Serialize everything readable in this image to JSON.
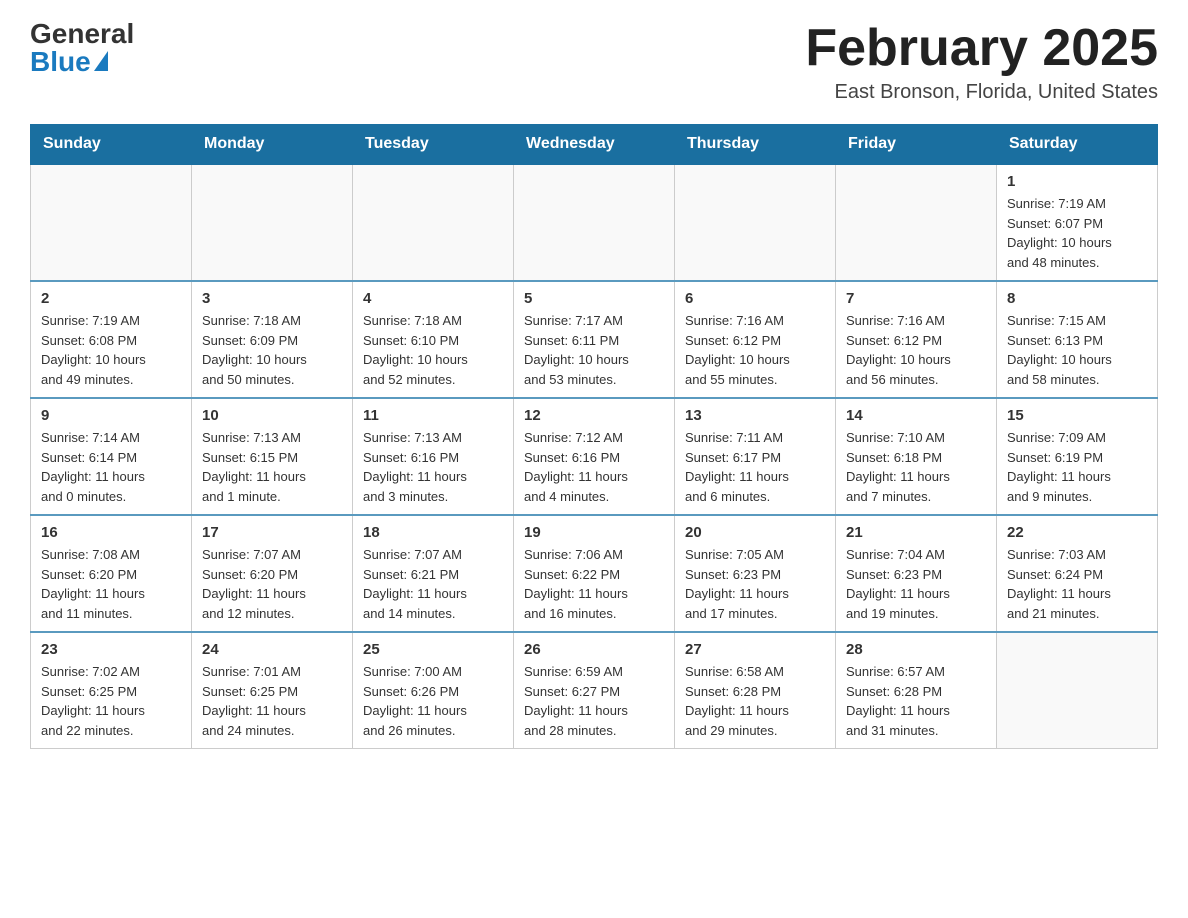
{
  "logo": {
    "general": "General",
    "blue": "Blue"
  },
  "title": "February 2025",
  "location": "East Bronson, Florida, United States",
  "days_of_week": [
    "Sunday",
    "Monday",
    "Tuesday",
    "Wednesday",
    "Thursday",
    "Friday",
    "Saturday"
  ],
  "weeks": [
    [
      {
        "day": "",
        "info": ""
      },
      {
        "day": "",
        "info": ""
      },
      {
        "day": "",
        "info": ""
      },
      {
        "day": "",
        "info": ""
      },
      {
        "day": "",
        "info": ""
      },
      {
        "day": "",
        "info": ""
      },
      {
        "day": "1",
        "info": "Sunrise: 7:19 AM\nSunset: 6:07 PM\nDaylight: 10 hours\nand 48 minutes."
      }
    ],
    [
      {
        "day": "2",
        "info": "Sunrise: 7:19 AM\nSunset: 6:08 PM\nDaylight: 10 hours\nand 49 minutes."
      },
      {
        "day": "3",
        "info": "Sunrise: 7:18 AM\nSunset: 6:09 PM\nDaylight: 10 hours\nand 50 minutes."
      },
      {
        "day": "4",
        "info": "Sunrise: 7:18 AM\nSunset: 6:10 PM\nDaylight: 10 hours\nand 52 minutes."
      },
      {
        "day": "5",
        "info": "Sunrise: 7:17 AM\nSunset: 6:11 PM\nDaylight: 10 hours\nand 53 minutes."
      },
      {
        "day": "6",
        "info": "Sunrise: 7:16 AM\nSunset: 6:12 PM\nDaylight: 10 hours\nand 55 minutes."
      },
      {
        "day": "7",
        "info": "Sunrise: 7:16 AM\nSunset: 6:12 PM\nDaylight: 10 hours\nand 56 minutes."
      },
      {
        "day": "8",
        "info": "Sunrise: 7:15 AM\nSunset: 6:13 PM\nDaylight: 10 hours\nand 58 minutes."
      }
    ],
    [
      {
        "day": "9",
        "info": "Sunrise: 7:14 AM\nSunset: 6:14 PM\nDaylight: 11 hours\nand 0 minutes."
      },
      {
        "day": "10",
        "info": "Sunrise: 7:13 AM\nSunset: 6:15 PM\nDaylight: 11 hours\nand 1 minute."
      },
      {
        "day": "11",
        "info": "Sunrise: 7:13 AM\nSunset: 6:16 PM\nDaylight: 11 hours\nand 3 minutes."
      },
      {
        "day": "12",
        "info": "Sunrise: 7:12 AM\nSunset: 6:16 PM\nDaylight: 11 hours\nand 4 minutes."
      },
      {
        "day": "13",
        "info": "Sunrise: 7:11 AM\nSunset: 6:17 PM\nDaylight: 11 hours\nand 6 minutes."
      },
      {
        "day": "14",
        "info": "Sunrise: 7:10 AM\nSunset: 6:18 PM\nDaylight: 11 hours\nand 7 minutes."
      },
      {
        "day": "15",
        "info": "Sunrise: 7:09 AM\nSunset: 6:19 PM\nDaylight: 11 hours\nand 9 minutes."
      }
    ],
    [
      {
        "day": "16",
        "info": "Sunrise: 7:08 AM\nSunset: 6:20 PM\nDaylight: 11 hours\nand 11 minutes."
      },
      {
        "day": "17",
        "info": "Sunrise: 7:07 AM\nSunset: 6:20 PM\nDaylight: 11 hours\nand 12 minutes."
      },
      {
        "day": "18",
        "info": "Sunrise: 7:07 AM\nSunset: 6:21 PM\nDaylight: 11 hours\nand 14 minutes."
      },
      {
        "day": "19",
        "info": "Sunrise: 7:06 AM\nSunset: 6:22 PM\nDaylight: 11 hours\nand 16 minutes."
      },
      {
        "day": "20",
        "info": "Sunrise: 7:05 AM\nSunset: 6:23 PM\nDaylight: 11 hours\nand 17 minutes."
      },
      {
        "day": "21",
        "info": "Sunrise: 7:04 AM\nSunset: 6:23 PM\nDaylight: 11 hours\nand 19 minutes."
      },
      {
        "day": "22",
        "info": "Sunrise: 7:03 AM\nSunset: 6:24 PM\nDaylight: 11 hours\nand 21 minutes."
      }
    ],
    [
      {
        "day": "23",
        "info": "Sunrise: 7:02 AM\nSunset: 6:25 PM\nDaylight: 11 hours\nand 22 minutes."
      },
      {
        "day": "24",
        "info": "Sunrise: 7:01 AM\nSunset: 6:25 PM\nDaylight: 11 hours\nand 24 minutes."
      },
      {
        "day": "25",
        "info": "Sunrise: 7:00 AM\nSunset: 6:26 PM\nDaylight: 11 hours\nand 26 minutes."
      },
      {
        "day": "26",
        "info": "Sunrise: 6:59 AM\nSunset: 6:27 PM\nDaylight: 11 hours\nand 28 minutes."
      },
      {
        "day": "27",
        "info": "Sunrise: 6:58 AM\nSunset: 6:28 PM\nDaylight: 11 hours\nand 29 minutes."
      },
      {
        "day": "28",
        "info": "Sunrise: 6:57 AM\nSunset: 6:28 PM\nDaylight: 11 hours\nand 31 minutes."
      },
      {
        "day": "",
        "info": ""
      }
    ]
  ]
}
